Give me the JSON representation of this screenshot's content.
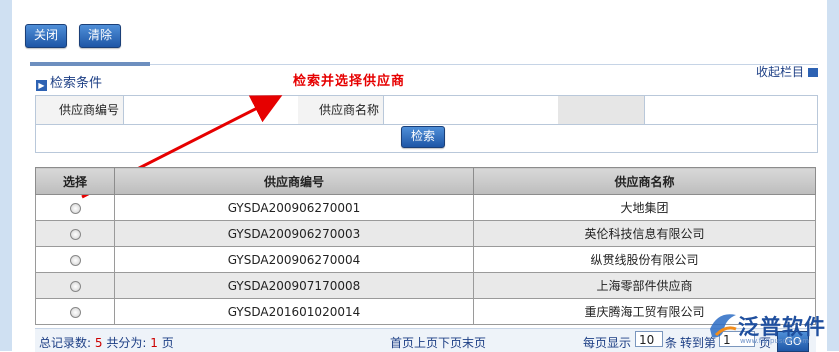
{
  "toolbar": {
    "close_label": "关闭",
    "clear_label": "清除"
  },
  "panel": {
    "title": "检索条件",
    "annotation": "检索并选择供应商",
    "collapse_label": "收起栏目"
  },
  "search": {
    "supplier_code_label": "供应商编号",
    "supplier_code_value": "",
    "supplier_name_label": "供应商名称",
    "supplier_name_value": "",
    "search_button": "检索"
  },
  "table": {
    "columns": [
      "选择",
      "供应商编号",
      "供应商名称"
    ],
    "rows": [
      {
        "code": "GYSDA200906270001",
        "name": "大地集团"
      },
      {
        "code": "GYSDA200906270003",
        "name": "英伦科技信息有限公司"
      },
      {
        "code": "GYSDA200906270004",
        "name": "纵贯线股份有限公司"
      },
      {
        "code": "GYSDA200907170008",
        "name": "上海零部件供应商"
      },
      {
        "code": "GYSDA201601020014",
        "name": "重庆腾海工贸有限公司"
      }
    ]
  },
  "footer": {
    "total_label": "总记录数:",
    "total_value": "5",
    "pages_label": "共分为:",
    "pages_value": "1",
    "pages_unit": "页",
    "nav_links": [
      "首页",
      "上页",
      "下页",
      "末页"
    ],
    "per_page_label": "每页显示",
    "per_page_value": "10",
    "per_page_unit": "条",
    "goto_label": "转到第",
    "goto_value": "1",
    "goto_unit": "页",
    "go_button": "GO"
  },
  "logo": {
    "text": "泛普软件",
    "sub": "www.fanpusoft.com"
  },
  "colors": {
    "accent": "#1e56a6",
    "annotation": "#e60000",
    "frame": "#cfe0f2"
  }
}
